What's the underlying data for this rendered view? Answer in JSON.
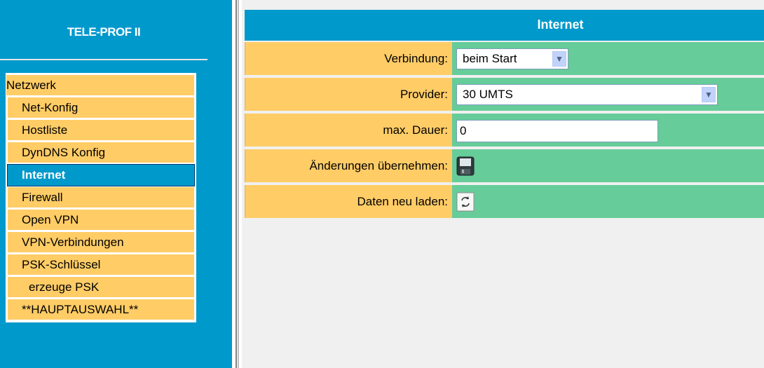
{
  "sidebar": {
    "brand": "TELE-PROF II",
    "items": [
      {
        "label": "Netzwerk",
        "level": 0,
        "active": false
      },
      {
        "label": "Net-Konfig",
        "level": 1,
        "active": false
      },
      {
        "label": "Hostliste",
        "level": 1,
        "active": false
      },
      {
        "label": "DynDNS Konfig",
        "level": 1,
        "active": false
      },
      {
        "label": "Internet",
        "level": 1,
        "active": true
      },
      {
        "label": "Firewall",
        "level": 1,
        "active": false
      },
      {
        "label": "Open VPN",
        "level": 1,
        "active": false
      },
      {
        "label": "VPN-Verbindungen",
        "level": 1,
        "active": false
      },
      {
        "label": "PSK-Schlüssel",
        "level": 1,
        "active": false
      },
      {
        "label": "erzeuge PSK",
        "level": 2,
        "active": false
      },
      {
        "label": "**HAUPTAUSWAHL**",
        "level": 1,
        "active": false
      }
    ]
  },
  "main": {
    "title": "Internet",
    "form": {
      "connection_label": "Verbindung:",
      "connection_value": "beim Start",
      "provider_label": "Provider:",
      "provider_value": "30 UMTS",
      "duration_label": "max. Dauer:",
      "duration_value": "0",
      "apply_label": "Änderungen übernehmen:",
      "reload_label": "Daten neu laden:"
    }
  },
  "colors": {
    "accent_blue": "#0099cc",
    "label_orange": "#ffcc66",
    "value_green": "#66cc99"
  },
  "icons": {
    "apply": "save-icon",
    "reload": "refresh-icon",
    "dropdown": "chevron-down-icon"
  }
}
